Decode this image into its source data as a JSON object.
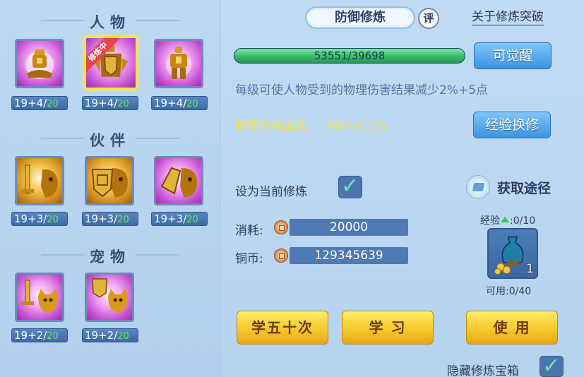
{
  "left_panel": {
    "sections": [
      {
        "title": "人物",
        "items": [
          {
            "level": "19+4/",
            "max": "20",
            "style": "pink",
            "selected": false,
            "badge": "",
            "icon": "meditating-warrior-icon"
          },
          {
            "level": "19+4/",
            "max": "20",
            "style": "pink",
            "selected": true,
            "badge": "修炼中",
            "icon": "shield-warrior-icon"
          },
          {
            "level": "19+4/",
            "max": "20",
            "style": "pink",
            "selected": false,
            "badge": "",
            "icon": "armored-warrior-icon"
          }
        ]
      },
      {
        "title": "伙伴",
        "items": [
          {
            "level": "19+3/",
            "max": "20",
            "style": "gold",
            "selected": false,
            "badge": "",
            "icon": "sword-beast-icon"
          },
          {
            "level": "19+3/",
            "max": "20",
            "style": "gold",
            "selected": false,
            "badge": "",
            "icon": "shield-beast-icon"
          },
          {
            "level": "19+3/",
            "max": "20",
            "style": "gold",
            "selected": false,
            "badge": "",
            "icon": "fist-beast-icon"
          }
        ]
      },
      {
        "title": "宠物",
        "items": [
          {
            "level": "19+2/",
            "max": "20",
            "style": "pink",
            "selected": false,
            "badge": "",
            "icon": "sword-cat-icon"
          },
          {
            "level": "19+2/",
            "max": "20",
            "style": "pink",
            "selected": false,
            "badge": "",
            "icon": "shield-cat-icon"
          }
        ]
      }
    ]
  },
  "header": {
    "title": "防御修炼",
    "rating_label": "评",
    "breakthrough_link": "关于修炼突破"
  },
  "progress": {
    "text": "53551/39698",
    "fill": 1.0
  },
  "buttons": {
    "awaken": "可觉醒",
    "exp_exchange": "经验换修",
    "learn_fifty": "学五十次",
    "learn": "学 习",
    "use": "使 用"
  },
  "description": "每级可使人物受到的物理伤害结果减少2%+5点",
  "stat": {
    "label": "物理伤害减免:",
    "value": "46%+115"
  },
  "set_current": {
    "label": "设为当前修炼",
    "checked": true
  },
  "get_way": "获取途径",
  "costs": {
    "consume_label": "消耗:",
    "consume_value": "20000",
    "coin_label": "铜币:",
    "coin_value": "129345639"
  },
  "item": {
    "exp_label_prefix": "经验",
    "exp_label_suffix": ":0/10",
    "count": "1",
    "available": "可用:0/40",
    "icon": "vase-with-coins-icon"
  },
  "hide_chest": {
    "label": "隐藏修炼宝箱",
    "checked": true
  },
  "colors": {
    "accent_blue": "#3c94e0",
    "gold_button": "#f6c929",
    "stat_yellow": "#f3e34a",
    "level_green": "#5ff04a"
  }
}
